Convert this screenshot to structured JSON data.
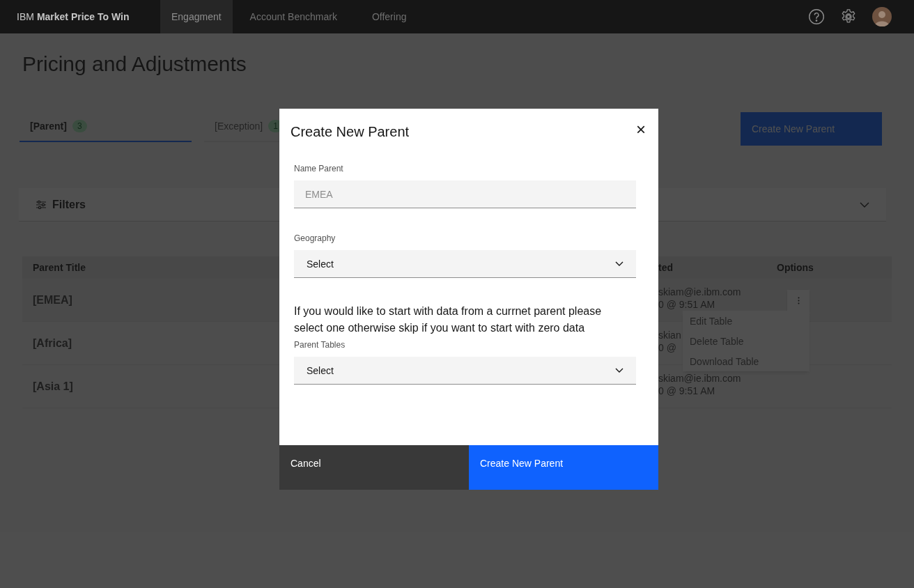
{
  "top_nav": {
    "brand_prefix": "IBM",
    "brand_name": "Market Price To Win",
    "tabs": [
      {
        "label": "Engagment",
        "selected": true
      },
      {
        "label": "Account Benchmark",
        "selected": false
      },
      {
        "label": "Offering",
        "selected": false
      }
    ]
  },
  "page": {
    "title": "Pricing and Adjustments",
    "tabs": [
      {
        "label": "[Parent]",
        "count": "3",
        "selected": true
      },
      {
        "label": "[Exception]",
        "count": "1",
        "selected": false
      }
    ],
    "create_button": "Create New Parent",
    "filters": {
      "label": "Filters"
    },
    "table": {
      "columns": [
        "Parent Title",
        "ted",
        "Options"
      ],
      "rows": [
        {
          "title": "[EMEA]",
          "created_by": "skiam@ie.ibm.com",
          "created_at": "0 @ 9:51 AM",
          "menu_open": true
        },
        {
          "title": "[Africa]",
          "created_by": "skian",
          "created_at": "0 @",
          "menu_open": false
        },
        {
          "title": "[Asia 1]",
          "created_by": "skiam@ie.ibm.com",
          "created_at": "0 @ 9:51 AM",
          "menu_open": false
        }
      ]
    },
    "row_menu": {
      "items": [
        "Edit Table",
        "Delete Table",
        "Download Table"
      ]
    }
  },
  "modal": {
    "title": "Create New Parent",
    "close": "×",
    "name_field": {
      "label": "Name Parent",
      "placeholder": "EMEA"
    },
    "geography": {
      "label": "Geography",
      "value": "Select"
    },
    "hint": "If you would like to start with data from a currnet parent please select one otherwise skip if you want to start with zero data",
    "parent_tables": {
      "label": "Parent Tables",
      "value": "Select"
    },
    "buttons": [
      {
        "label": "Cancel",
        "kind": "secondary"
      },
      {
        "label": "Create New Parent",
        "kind": "primary"
      }
    ]
  }
}
